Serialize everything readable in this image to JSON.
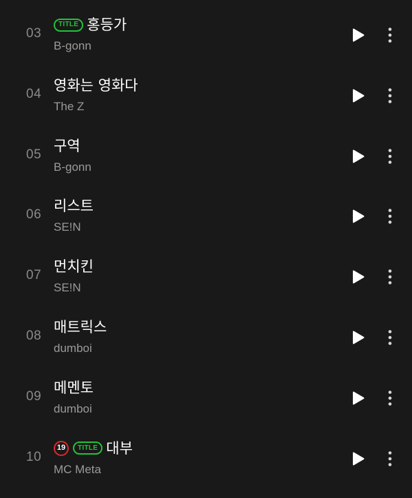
{
  "colors": {
    "background": "#191919",
    "title_badge": "#22c33a",
    "age_badge": "#e0282d",
    "track_number": "#8a8a8a",
    "artist_text": "#9a9a9a"
  },
  "tracks": [
    {
      "number": "03",
      "title": "홍등가",
      "artist": "B-gonn",
      "title_badge": "TITLE",
      "age_badge": null
    },
    {
      "number": "04",
      "title": "영화는 영화다",
      "artist": "The Z",
      "title_badge": null,
      "age_badge": null
    },
    {
      "number": "05",
      "title": "구역",
      "artist": "B-gonn",
      "title_badge": null,
      "age_badge": null
    },
    {
      "number": "06",
      "title": "리스트",
      "artist": "SE!N",
      "title_badge": null,
      "age_badge": null
    },
    {
      "number": "07",
      "title": "먼치킨",
      "artist": "SE!N",
      "title_badge": null,
      "age_badge": null
    },
    {
      "number": "08",
      "title": "매트릭스",
      "artist": "dumboi",
      "title_badge": null,
      "age_badge": null
    },
    {
      "number": "09",
      "title": "메멘토",
      "artist": "dumboi",
      "title_badge": null,
      "age_badge": null
    },
    {
      "number": "10",
      "title": "대부",
      "artist": "MC Meta",
      "title_badge": "TITLE",
      "age_badge": "19"
    }
  ],
  "icons": {
    "play": "play-icon",
    "more": "more-vertical-icon"
  }
}
